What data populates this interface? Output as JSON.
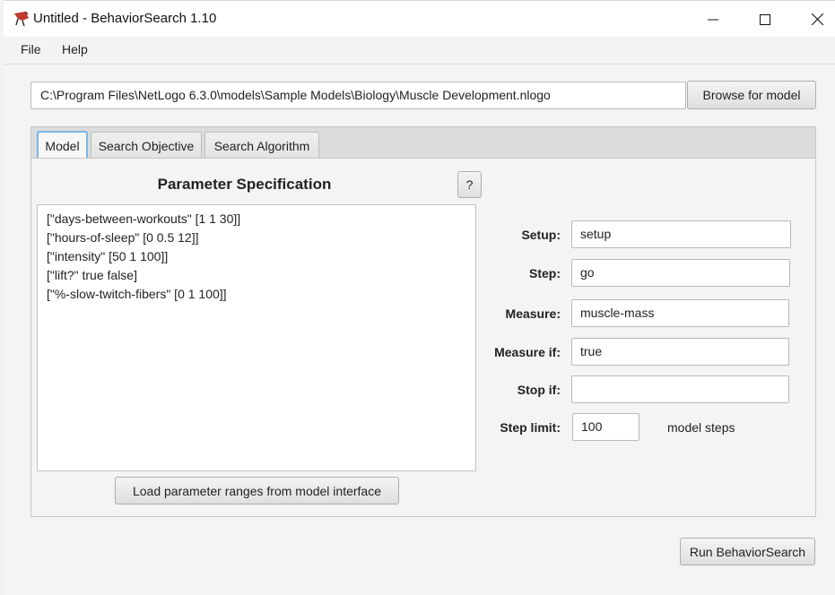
{
  "window": {
    "title": "Untitled - BehaviorSearch 1.10"
  },
  "menu": [
    "File",
    "Help"
  ],
  "model_path": "C:\\Program Files\\NetLogo 6.3.0\\models\\Sample Models\\Biology\\Muscle Development.nlogo",
  "browse_label": "Browse for model",
  "tabs": [
    "Model",
    "Search Objective",
    "Search Algorithm"
  ],
  "selected_tab": "Model",
  "param_spec": {
    "title": "Parameter Specification",
    "help": "?",
    "lines": [
      "[\"days-between-workouts\" [1 1 30]]",
      "[\"hours-of-sleep\" [0 0.5 12]]",
      "[\"intensity\" [50 1 100]]",
      "[\"lift?\" true false]",
      "[\"%-slow-twitch-fibers\" [0 1 100]]"
    ],
    "load_label": "Load parameter ranges from model interface"
  },
  "form": {
    "setup_label": "Setup:",
    "setup_value": "setup",
    "step_label": "Step:",
    "step_value": "go",
    "measure_label": "Measure:",
    "measure_value": "muscle-mass",
    "measure_if_label": "Measure if:",
    "measure_if_value": "true",
    "stop_if_label": "Stop if:",
    "stop_if_value": "",
    "step_limit_label": "Step limit:",
    "step_limit_value": "100",
    "step_limit_unit": "model steps"
  },
  "run_label": "Run BehaviorSearch",
  "colors": {
    "tab_focus": "#79b7e6",
    "app_icon": "#c0392b"
  }
}
